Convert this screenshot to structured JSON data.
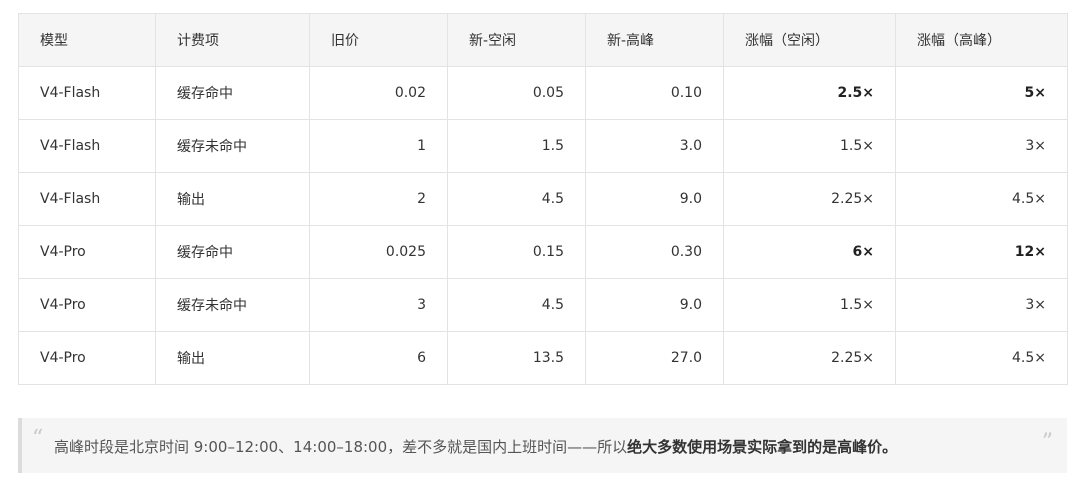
{
  "table": {
    "headers": [
      "模型",
      "计费项",
      "旧价",
      "新-空闲",
      "新-高峰",
      "涨幅（空闲）",
      "涨幅（高峰）"
    ],
    "rows": [
      {
        "model": "V4-Flash",
        "item": "缓存命中",
        "old": "0.02",
        "idle": "0.05",
        "peak": "0.10",
        "inc_idle": "2.5×",
        "inc_peak": "5×"
      },
      {
        "model": "V4-Flash",
        "item": "缓存未命中",
        "old": "1",
        "idle": "1.5",
        "peak": "3.0",
        "inc_idle": "1.5×",
        "inc_peak": "3×"
      },
      {
        "model": "V4-Flash",
        "item": "输出",
        "old": "2",
        "idle": "4.5",
        "peak": "9.0",
        "inc_idle": "2.25×",
        "inc_peak": "4.5×"
      },
      {
        "model": "V4-Pro",
        "item": "缓存命中",
        "old": "0.025",
        "idle": "0.15",
        "peak": "0.30",
        "inc_idle": "6×",
        "inc_peak": "12×"
      },
      {
        "model": "V4-Pro",
        "item": "缓存未命中",
        "old": "3",
        "idle": "4.5",
        "peak": "9.0",
        "inc_idle": "1.5×",
        "inc_peak": "3×"
      },
      {
        "model": "V4-Pro",
        "item": "输出",
        "old": "6",
        "idle": "13.5",
        "peak": "27.0",
        "inc_idle": "2.25×",
        "inc_peak": "4.5×"
      }
    ]
  },
  "quote": {
    "open_mark": "“",
    "close_mark": "”",
    "text_plain": "高峰时段是北京时间 9:00–12:00、14:00–18:00，差不多就是国内上班时间——所以",
    "text_bold": "绝大多数使用场景实际拿到的是高峰价。"
  }
}
